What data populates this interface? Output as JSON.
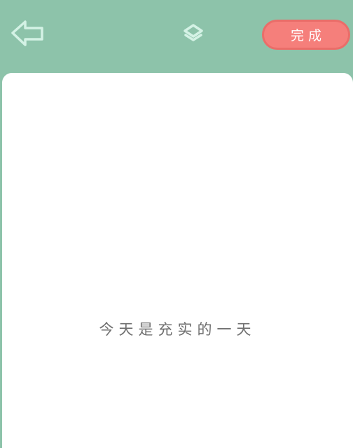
{
  "toolbar": {
    "back_icon": "back-arrow-icon",
    "layers_icon": "layers-icon",
    "done_label": "完成"
  },
  "note": {
    "text": "今天是充实的一天"
  },
  "colors": {
    "background": "#8dc3aa",
    "icon": "#d4f2e5",
    "accent": "#f57f7b",
    "card": "#ffffff",
    "text": "#6f6f6f"
  }
}
